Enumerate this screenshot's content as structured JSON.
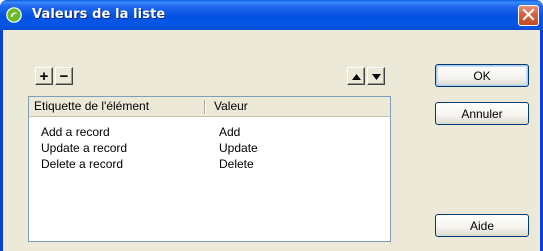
{
  "window": {
    "title": "Valeurs de la liste",
    "app_icon": "dreamweaver-icon",
    "close_icon": "close-icon"
  },
  "toolbar": {
    "add_label": "+",
    "remove_label": "−",
    "move_up_icon": "triangle-up-icon",
    "move_down_icon": "triangle-down-icon"
  },
  "list": {
    "columns": [
      "Etiquette de l'élément",
      "Valeur"
    ],
    "rows": [
      {
        "label": "Add a record",
        "value": "Add"
      },
      {
        "label": "Update a record",
        "value": "Update"
      },
      {
        "label": "Delete a record",
        "value": "Delete"
      }
    ]
  },
  "buttons": {
    "ok": "OK",
    "cancel": "Annuler",
    "help": "Aide"
  },
  "colors": {
    "titlebar": "#0452e3",
    "dialog_bg": "#ece9d8",
    "close_button": "#d4603c",
    "list_border": "#7f9db9"
  }
}
